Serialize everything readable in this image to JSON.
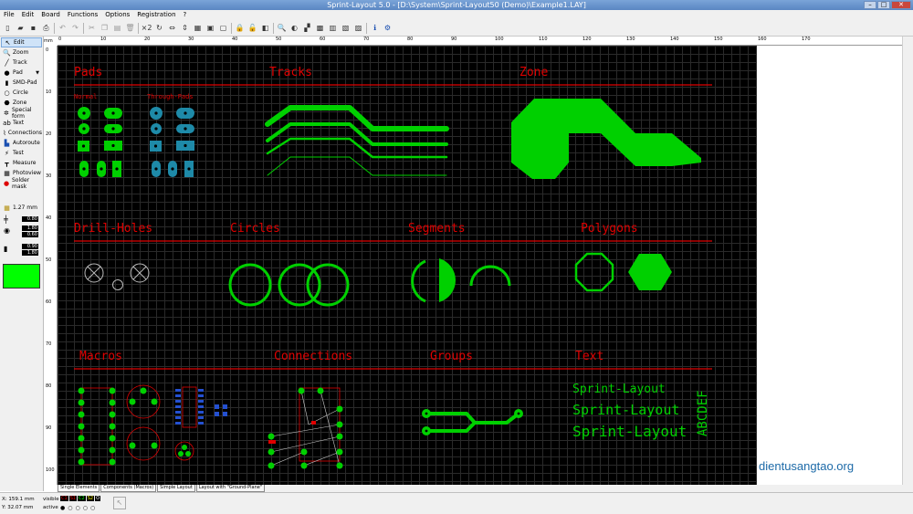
{
  "window": {
    "title": "Sprint-Layout 5.0 - [D:\\System\\Sprint-Layout50 (Demo)\\Example1.LAY]"
  },
  "menu": [
    "File",
    "Edit",
    "Board",
    "Functions",
    "Options",
    "Registration",
    "?"
  ],
  "tools": [
    {
      "label": "Edit",
      "icon": "cursor-icon"
    },
    {
      "label": "Zoom",
      "icon": "magnifier-icon"
    },
    {
      "label": "Track",
      "icon": "pen-icon"
    },
    {
      "label": "Pad",
      "icon": "pad-icon"
    },
    {
      "label": "SMD-Pad",
      "icon": "smd-icon"
    },
    {
      "label": "Circle",
      "icon": "circle-icon"
    },
    {
      "label": "Zone",
      "icon": "zone-icon"
    },
    {
      "label": "Special form",
      "icon": "special-form-icon"
    },
    {
      "label": "Text",
      "icon": "text-icon"
    },
    {
      "label": "Connections",
      "icon": "connections-icon"
    },
    {
      "label": "Autoroute",
      "icon": "autoroute-icon"
    },
    {
      "label": "Test",
      "icon": "test-icon"
    },
    {
      "label": "Measure",
      "icon": "ruler-icon"
    },
    {
      "label": "Photoview",
      "icon": "photo-icon"
    },
    {
      "label": "Solder mask",
      "icon": "solder-mask-icon"
    }
  ],
  "grid": {
    "value": "1.27 mm"
  },
  "params": {
    "track_width": "0.80",
    "pad_outer": "1.80",
    "pad_inner": "0.60",
    "smd_w": "0.90",
    "smd_h": "1.80"
  },
  "active_color": "#00ff00",
  "ruler": {
    "unit": "mm",
    "h_labels": [
      "0",
      "10",
      "20",
      "30",
      "40",
      "50",
      "60",
      "70",
      "80",
      "90",
      "100",
      "110",
      "120",
      "130",
      "140",
      "150",
      "160",
      "170"
    ],
    "v_labels": [
      "0",
      "10",
      "20",
      "30",
      "40",
      "50",
      "60",
      "70",
      "80",
      "90",
      "100"
    ]
  },
  "board": {
    "sections": [
      "Pads",
      "Tracks",
      "Zone",
      "Drill-Holes",
      "Circles",
      "Segments",
      "Polygons",
      "Macros",
      "Connections",
      "Groups",
      "Text"
    ],
    "pads_sub": [
      "Normal",
      "Through-Pads"
    ],
    "sample_texts": [
      "Sprint-Layout",
      "Sprint-Layout",
      "Sprint-Layout",
      "ABCDEF"
    ]
  },
  "tabs": [
    "Single Elements",
    "Components (Macros)",
    "Simple Layout",
    "Layout with \"Ground-Plane\""
  ],
  "status": {
    "x": "X: 159.1 mm",
    "y": "Y: 32.07 mm",
    "visible": "visible",
    "active": "active",
    "layers": [
      "C1",
      "S1",
      "C2",
      "S2",
      "O"
    ]
  },
  "watermark": "dientusangtao.org",
  "colors": {
    "copper_top": "#00d000",
    "copper_inner": "#1e8aa8",
    "silk": "#e00000"
  }
}
